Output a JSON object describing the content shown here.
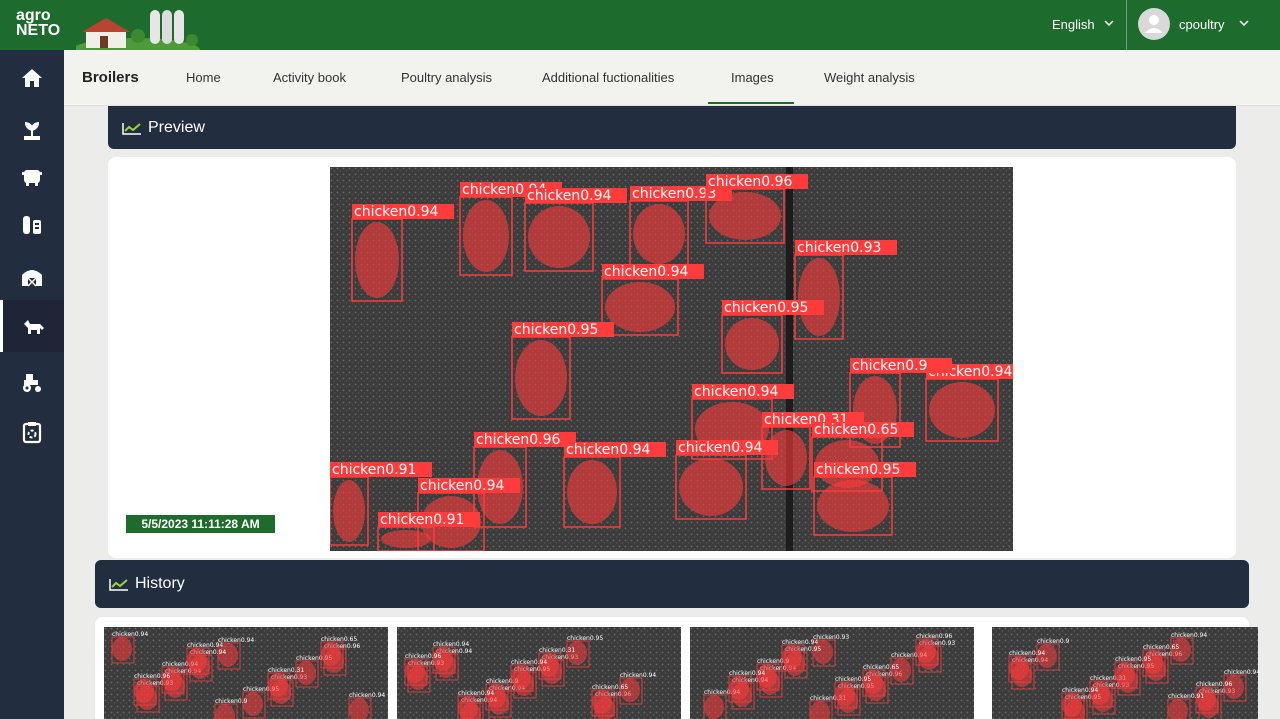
{
  "brand": {
    "logo_line1": "agro",
    "logo_line2": "NETO"
  },
  "header": {
    "language": "English",
    "username": "cpoultry"
  },
  "sidebar": {
    "items": [
      {
        "icon": "home-icon"
      },
      {
        "icon": "plant-icon"
      },
      {
        "icon": "hive-icon"
      },
      {
        "icon": "silo-icon"
      },
      {
        "icon": "barn-icon"
      },
      {
        "icon": "livestock-icon",
        "active": true
      },
      {
        "icon": "tractor-icon"
      },
      {
        "icon": "clipboard-icon"
      }
    ]
  },
  "navbar": {
    "section": "Broilers",
    "tabs": [
      {
        "label": "Home"
      },
      {
        "label": "Activity book"
      },
      {
        "label": "Poultry analysis"
      },
      {
        "label": "Additional fuctionalities"
      },
      {
        "label": "Images",
        "active": true
      },
      {
        "label": "Weight analysis"
      }
    ]
  },
  "preview": {
    "title": "Preview",
    "timestamp": "5/5/2023 11:11:28 AM",
    "detections": [
      {
        "label": "chicken",
        "score": "0.94"
      },
      {
        "label": "chicken",
        "score": "0.94"
      },
      {
        "label": "chicken",
        "score": "0.94"
      },
      {
        "label": "chicken",
        "score": "0.93"
      },
      {
        "label": "chicken",
        "score": "0.96"
      },
      {
        "label": "chicken",
        "score": "0.93"
      },
      {
        "label": "chicken",
        "score": "0.94"
      },
      {
        "label": "chicken",
        "score": "0.95"
      },
      {
        "label": "chicken",
        "score": "0.95"
      },
      {
        "label": "chicken",
        "score": "0.94"
      },
      {
        "label": "chicken",
        "score": "0.94"
      },
      {
        "label": "chicken",
        "score": "0.9"
      },
      {
        "label": "chicken",
        "score": "0.31"
      },
      {
        "label": "chicken",
        "score": "0.65"
      },
      {
        "label": "chicken",
        "score": "0.96"
      },
      {
        "label": "chicken",
        "score": "0.94"
      },
      {
        "label": "chicken",
        "score": "0.94"
      },
      {
        "label": "chicken",
        "score": "0.95"
      },
      {
        "label": "chicken",
        "score": "0.91"
      },
      {
        "label": "chicken",
        "score": "0.94"
      },
      {
        "label": "chicken",
        "score": "0.91"
      }
    ]
  },
  "history": {
    "title": "History"
  },
  "colors": {
    "brand_green": "#1e6b2e",
    "navy": "#232d40",
    "detection_red": "#ff3b3b"
  }
}
